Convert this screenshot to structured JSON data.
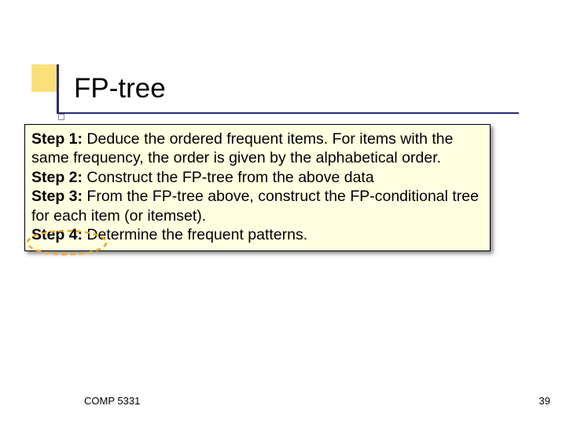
{
  "title": "FP-tree",
  "steps": {
    "s1_label": "Step 1:",
    "s1_text": " Deduce the ordered frequent items. For items with the same frequency, the order is given by the alphabetical order.",
    "s2_label": "Step 2:",
    "s2_text": " Construct the FP-tree from the above data",
    "s3_label": "Step 3:",
    "s3_text": " From the FP-tree above, construct the FP-conditional tree for each item (or itemset).",
    "s4_label": "Step 4:",
    "s4_text": " Determine the frequent patterns."
  },
  "footer": {
    "course": "COMP 5331",
    "page": "39"
  }
}
